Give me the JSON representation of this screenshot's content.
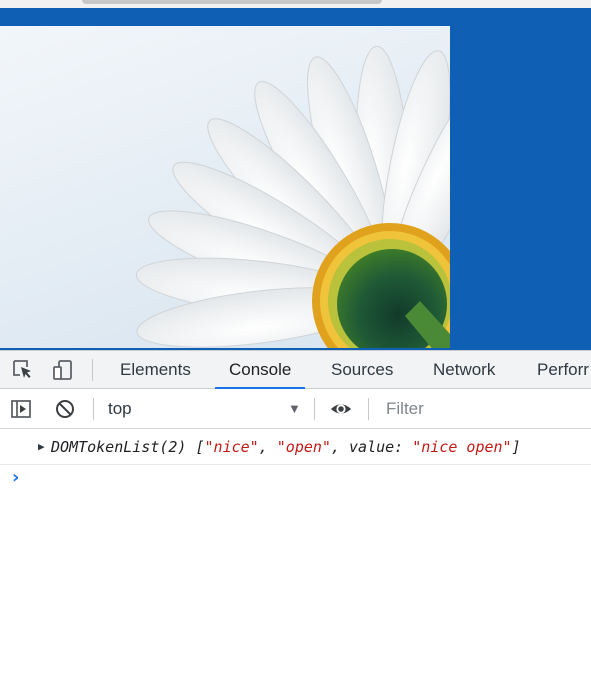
{
  "devtools": {
    "tabs": [
      {
        "label": "Elements"
      },
      {
        "label": "Console",
        "active": true
      },
      {
        "label": "Sources"
      },
      {
        "label": "Network"
      },
      {
        "label": "Perforr"
      }
    ],
    "toolbar": {
      "context": "top",
      "filter_placeholder": "Filter"
    },
    "console": {
      "entry": {
        "type_name": "DOMTokenList(2)",
        "open_bracket": "[",
        "item1": "\"nice\"",
        "sep1": ", ",
        "item2": "\"open\"",
        "sep2": ", ",
        "value_key": "value: ",
        "value": "\"nice open\"",
        "close_bracket": "]"
      },
      "prompt": "›"
    },
    "icons": [
      "inspect-icon",
      "device-toolbar-icon",
      "sidebar-toggle-icon",
      "clear-console-icon",
      "eye-icon",
      "dropdown-arrow-icon",
      "expand-triangle-icon"
    ]
  },
  "colors": {
    "page_background": "#0f5fb4",
    "active_tab_underline": "#1a73e8",
    "string_value": "#c41a16",
    "prompt": "#1a73e8"
  }
}
